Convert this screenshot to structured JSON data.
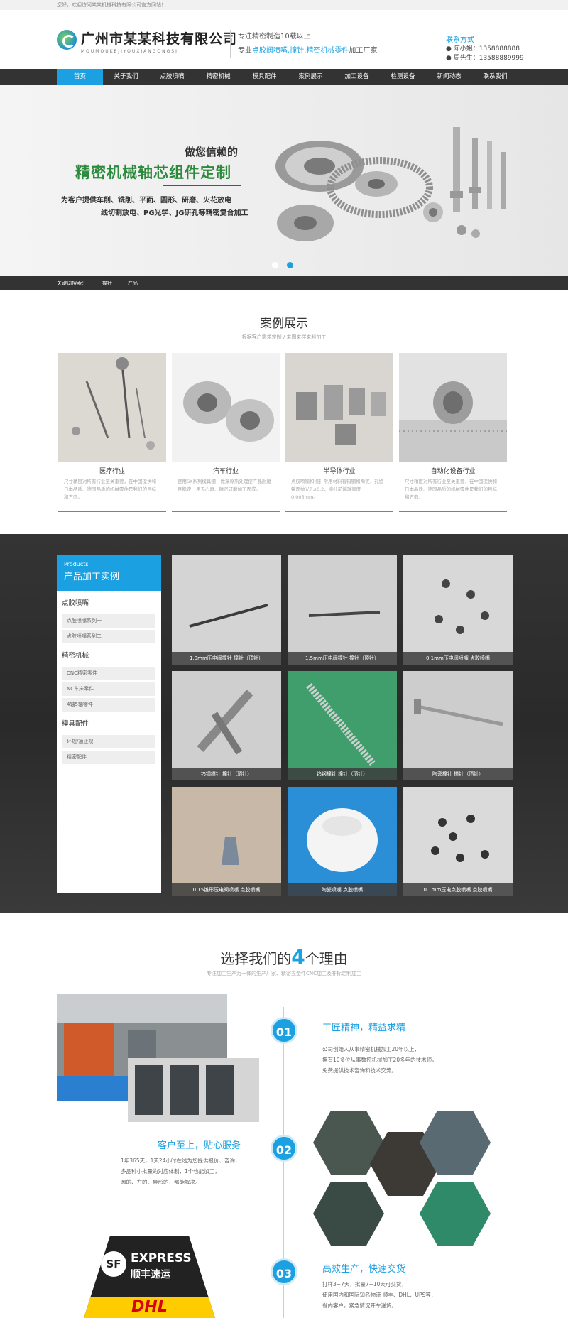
{
  "topbar": {
    "text": "您好，欢迎访问某某机械科技有限公司官方网站！"
  },
  "header": {
    "company": "广州市某某科技有限公司",
    "pinyin": "MOUMOUKEJIYOUXIANGONGSI",
    "slogan_line1": "专注精密制造10载以上",
    "slogan_line2_prefix": "专业",
    "slogan_line2_highlight": "点胶阀喷嘴,撞针,精密机械零件",
    "slogan_line2_suffix": "加工厂家",
    "contact_title": "联系方式",
    "contact_1": "● 陈小姐：1358888888",
    "contact_2": "● 周先生：13588889999"
  },
  "nav": [
    "首页",
    "关于我们",
    "点胶喷嘴",
    "精密机械",
    "模具配件",
    "案例展示",
    "加工设备",
    "检测设备",
    "新闻动态",
    "联系我们"
  ],
  "banner": {
    "line1": "做您信赖的",
    "line2": "精密机械轴芯组件定制",
    "line3": "为客户提供车削、铣削、平面、圆形、研磨、火花放电",
    "line4": "线切割放电、PG光学、JG研孔等精密复合加工"
  },
  "keywords": {
    "label": "关键词搜索：",
    "items": [
      "撞针",
      "产品"
    ]
  },
  "cases": {
    "title": "案例展示",
    "subtitle": "根据客户需求定制 / 来图来样来料加工",
    "items": [
      {
        "name": "医疗行业",
        "desc": "尺寸精度对所有行业至关重要，在中国提供和日本品质、德国品质的机械零件是我们的目标和方向。"
      },
      {
        "name": "汽车行业",
        "desc": "使用SK系列模具钢，做深冷热处理使产品耐磨且稳定、用无心磨、精密研磨加工而成。"
      },
      {
        "name": "半导体行业",
        "desc": "点胶喷嘴和撞针常用材料有钨钢和陶瓷，孔壁镜面抛光R≤0.2，撞针前端球面度0.005mm。"
      },
      {
        "name": "自动化设备行业",
        "desc": "尺寸精度对所有行业至关重要，在中国提供和日本品质、德国品质的机械零件是我们的目标和方向。"
      }
    ]
  },
  "products": {
    "side_en": "Products",
    "side_cn": "产品加工实例",
    "cat1": "点胶喷嘴",
    "cat1_subs": [
      "点胶喷嘴系列一",
      "点胶喷嘴系列二"
    ],
    "cat2": "精密机械",
    "cat2_subs": [
      "CNC精密零件",
      "NC车床零件",
      "4轴5轴零件"
    ],
    "cat3": "模具配件",
    "cat3_subs": [
      "环规/通止规",
      "精密配件"
    ],
    "items": [
      "1.0mm压电阀撞针 撞针（顶针）",
      "1.5mm压电阀撞针 撞针（顶针）",
      "0.1mm压电阀喷嘴 点胶喷嘴",
      "钨钢撞针 撞针（顶针）",
      "钨钢撞针 撞针（顶针）",
      "陶瓷撞针 撞针（顶针）",
      "0.15锥形压电阀喷嘴 点胶喷嘴",
      "陶瓷喷嘴 点胶喷嘴",
      "0.1mm压电点胶喷嘴 点胶喷嘴"
    ]
  },
  "reasons": {
    "title_prefix": "选择我们的",
    "title_num": "4",
    "title_suffix": "个理由",
    "subtitle": "专注加工生产为一体的生产厂家、精密五金件CNC加工及非标定制加工",
    "r1_num": "01",
    "r1_title": "工匠精神，精益求精",
    "r1_text": [
      "公司创始人从事精密机械加工20年以上，",
      "拥有10多位从事数控机械加工20多年的技术师，",
      "免费提供技术咨询和技术交流。"
    ],
    "r2_num": "02",
    "r2_title": "客户至上，贴心服务",
    "r2_text": [
      "1年365天，1天24小时在线为您提供报价、咨询，",
      "多品种小批量的对应体制，1个也能加工，",
      "圆的、方的、异形的，都能解决。"
    ],
    "r3_num": "03",
    "r3_title": "高效生产，快速交货",
    "r3_text": [
      "打样3~7天，批量7~10天可交货，",
      "使用国内和国际知名物流 顺丰、DHL、UPS等，",
      "省内客户，紧急情况开车送货。"
    ],
    "express_en": "EXPRESS",
    "express_cn": "顺丰速运",
    "dhl": "DHL"
  },
  "colors": {
    "accent": "#1ba0e2",
    "dark": "#333333",
    "banner_green": "#2c8a3c"
  }
}
